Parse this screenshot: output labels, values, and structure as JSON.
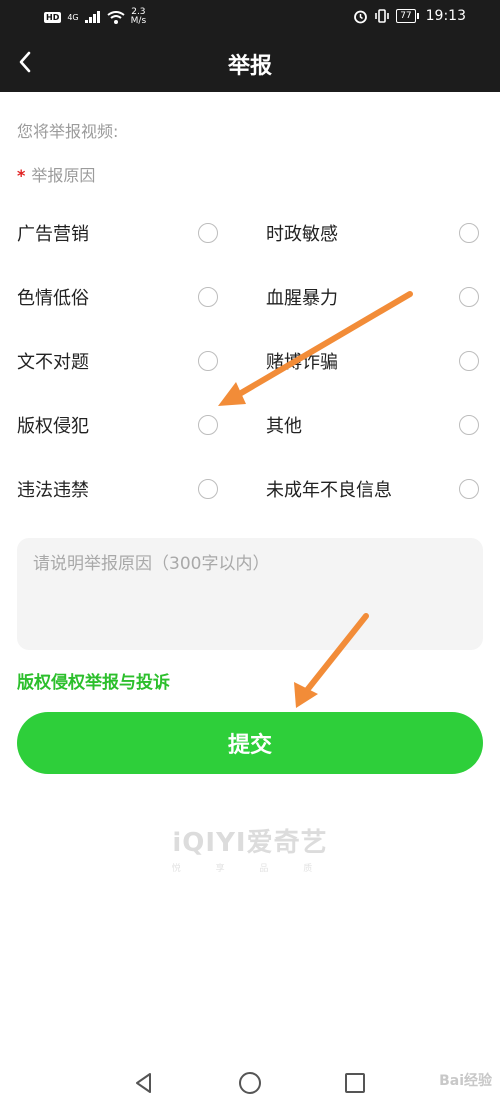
{
  "status_bar": {
    "hd": "HD",
    "network": "4G",
    "speed_value": "2.3",
    "speed_unit": "M/s",
    "battery": "77",
    "time": "19:13"
  },
  "nav": {
    "title": "举报"
  },
  "form": {
    "target_label": "您将举报视频:",
    "reason_title": "举报原因",
    "required_mark": "*",
    "options": [
      {
        "label": "广告营销"
      },
      {
        "label": "时政敏感"
      },
      {
        "label": "色情低俗"
      },
      {
        "label": "血腥暴力"
      },
      {
        "label": "文不对题"
      },
      {
        "label": "赌博诈骗"
      },
      {
        "label": "版权侵犯"
      },
      {
        "label": "其他"
      },
      {
        "label": "违法违禁"
      },
      {
        "label": "未成年不良信息"
      }
    ],
    "textarea_placeholder": "请说明举报原因（300字以内）",
    "copyright_link": "版权侵权举报与投诉",
    "submit_label": "提交"
  },
  "branding": {
    "logo_text": "iQIYI爱奇艺",
    "tagline": "悦 享 品 质"
  },
  "watermark": "Bai经验",
  "colors": {
    "header_bg": "#1c1c1c",
    "accent_green": "#2ecf3a",
    "link_green": "#2cbf2c",
    "required_red": "#e02020",
    "annotation_arrow": "#f28c38"
  }
}
